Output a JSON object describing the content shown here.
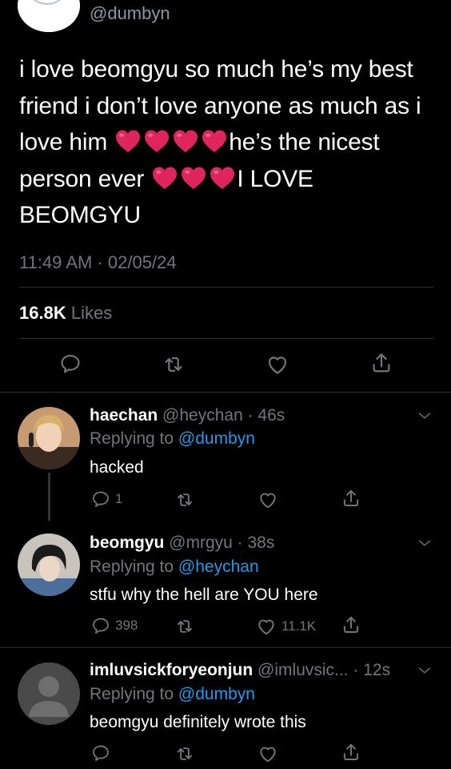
{
  "tweet": {
    "handle": "@dumbyn",
    "text_line1": "i love beomgyu so much he’s my best",
    "text_line2": "friend i don’t love anyone as much as i",
    "text_line3_pre": "love him ",
    "text_line3_post": "he’s the nicest",
    "text_line4_pre": "person ever ",
    "text_line4_post": "I LOVE",
    "text_line5": "BEOMGYU",
    "emoji": "❤️",
    "time": "11:49 AM · 02/05/24",
    "likes_count": "16.8K",
    "likes_label": " Likes"
  },
  "replies": [
    {
      "name": "haechan",
      "handle": " @heychan · 46s",
      "replying_label": "Replying to ",
      "replying_to": "@dumbyn",
      "text": "hacked",
      "reply_count": "1",
      "like_count": ""
    },
    {
      "name": "beomgyu",
      "handle": " @mrgyu · 38s",
      "replying_label": "Replying to ",
      "replying_to": "@heychan",
      "text": "stfu why the hell are YOU here",
      "reply_count": "398",
      "like_count": "11.1K"
    },
    {
      "name": "imluvsickforyeonjun",
      "handle": " @imluvsic... · 12s",
      "replying_label": "Replying to ",
      "replying_to": "@dumbyn",
      "text": "beomgyu definitely wrote this",
      "reply_count": "",
      "like_count": ""
    }
  ],
  "colors": {
    "background": "#000000",
    "muted": "#71767b",
    "link": "#1d9bf0",
    "heart": "#e0245e"
  },
  "icons": [
    "reply-icon",
    "retweet-icon",
    "like-icon",
    "share-icon",
    "chevron-down-icon",
    "heart-emoji"
  ]
}
